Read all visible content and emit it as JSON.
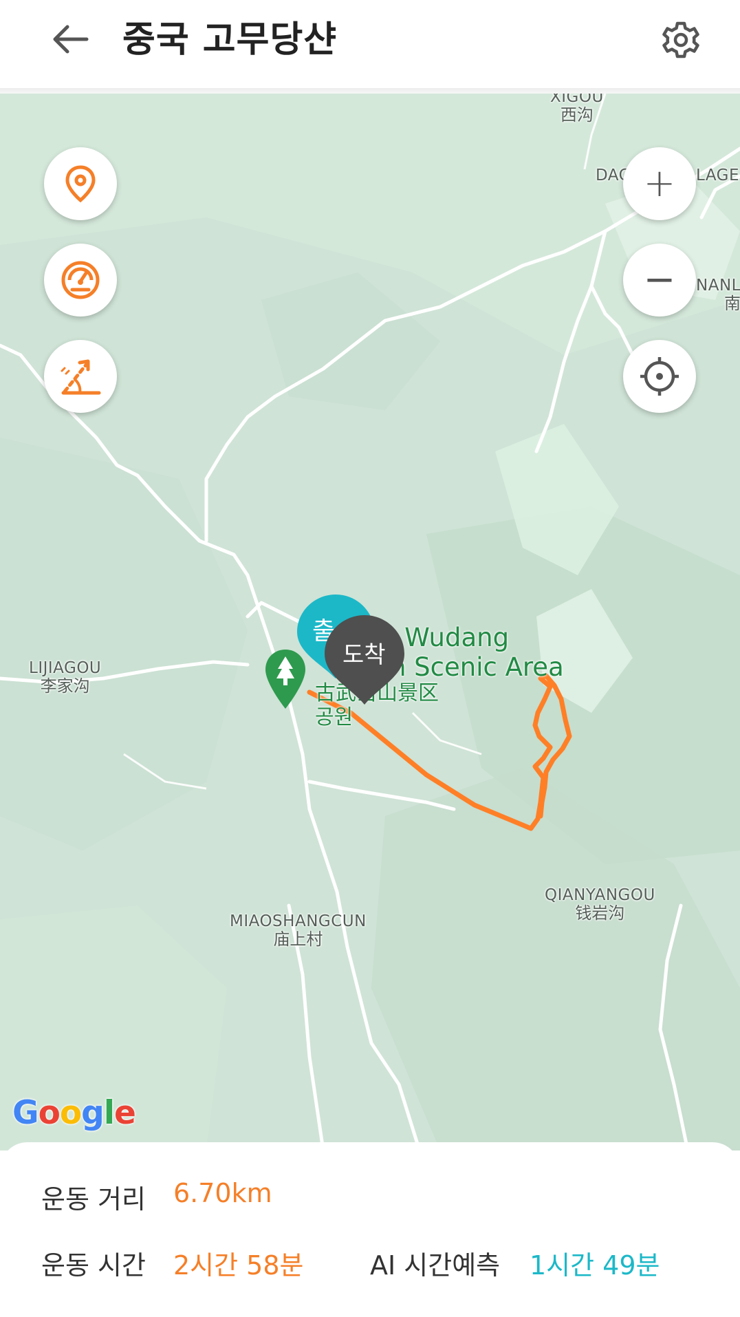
{
  "header": {
    "title": "중국 고무당샨",
    "back_icon": "back-arrow-icon",
    "settings_icon": "gear-icon"
  },
  "map": {
    "labels": [
      {
        "en": "XIGOU",
        "zh": "西沟"
      },
      {
        "en": "DAC",
        "zh": ""
      },
      {
        "en": "LAGE",
        "zh": ""
      },
      {
        "en": "NANL",
        "zh": "南"
      },
      {
        "en": "LIJIAGOU",
        "zh": "李家沟"
      },
      {
        "en": "QIANYANGOU",
        "zh": "钱岩沟"
      },
      {
        "en": "MIAOSHANGCUN",
        "zh": "庙上村"
      }
    ],
    "poi": {
      "line1": "t Wudang",
      "line2": "ain Scenic Area",
      "line3": "古武当山景区",
      "line4": "공원",
      "icon": "tree-icon"
    },
    "markers": {
      "start": "출",
      "end": "도착"
    },
    "route_color": "#ff7f27",
    "attribution": "Google",
    "controls": {
      "location_pin": "location-pin-icon",
      "speedometer": "speedometer-icon",
      "elevation": "elevation-icon",
      "zoom_in_label": "+",
      "zoom_out_label": "−",
      "my_location": "crosshair-icon"
    }
  },
  "stats": {
    "distance_label": "운동 거리",
    "distance_value": "6.70km",
    "time_label": "운동 시간",
    "time_value": "2시간 58분",
    "ai_label": "AI 시간예측",
    "ai_value": "1시간 49분"
  },
  "colors": {
    "accent_orange": "#f57f28",
    "accent_teal": "#1cb8c8",
    "map_bg": "#cfe3d6",
    "road": "#ffffff"
  }
}
